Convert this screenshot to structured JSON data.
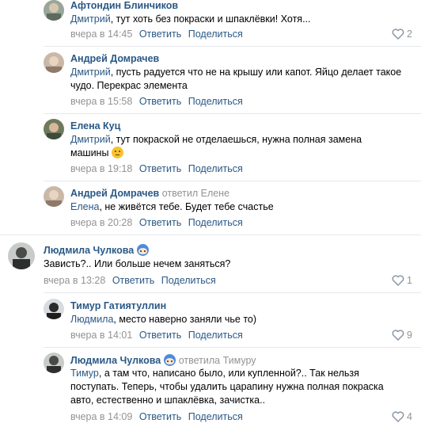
{
  "colors": {
    "link": "#2a5885",
    "muted": "#939393",
    "separator": "#e7e8ec"
  },
  "actions": {
    "reply": "Ответить",
    "share": "Поделиться"
  },
  "comments": [
    {
      "author": "Афтондин Блинчиков",
      "mention": "Дмитрий",
      "text": ", тут хоть без покраски и шпаклёвки! Хотя...",
      "time": "вчера в 14:45",
      "likes": "2"
    },
    {
      "author": "Андрей Домрачев",
      "mention": "Дмитрий",
      "text": ", пусть радуется что не на крышу или капот. Яйцо делает такое чудо. Перекрас элемента",
      "time": "вчера в 15:58",
      "likes": ""
    },
    {
      "author": "Елена Куц",
      "mention": "Дмитрий",
      "text": ", тут покраской не отделаешься, нужна полная замена машины",
      "time": "вчера в 19:18",
      "likes": "",
      "emoji": "thinking-emoji"
    },
    {
      "author": "Андрей Домрачев",
      "replied_to": "ответил Елене",
      "mention": "Елена",
      "text": ", не живётся тебе. Будет тебе счастье",
      "time": "вчера в 20:28",
      "likes": ""
    },
    {
      "author": "Людмила Чулкова",
      "text": "Зависть?.. Или больше нечем заняться?",
      "time": "вчера в 13:28",
      "likes": "1",
      "badge": "avatar-sticker-icon"
    },
    {
      "author": "Тимур Гатиятуллин",
      "mention": "Людмила",
      "text": ", место наверно заняли чье то)",
      "time": "вчера в 14:01",
      "likes": "9"
    },
    {
      "author": "Людмила Чулкова",
      "replied_to": "ответила Тимуру",
      "mention": "Тимур",
      "text": ", а там что, написано было, или купленной?.. Так нельзя поступать. Теперь, чтобы удалить царапину нужна полная покраска авто, естественно и шпаклёвка, зачистка..",
      "time": "вчера в 14:09",
      "likes": "4",
      "badge": "avatar-sticker-icon"
    }
  ]
}
